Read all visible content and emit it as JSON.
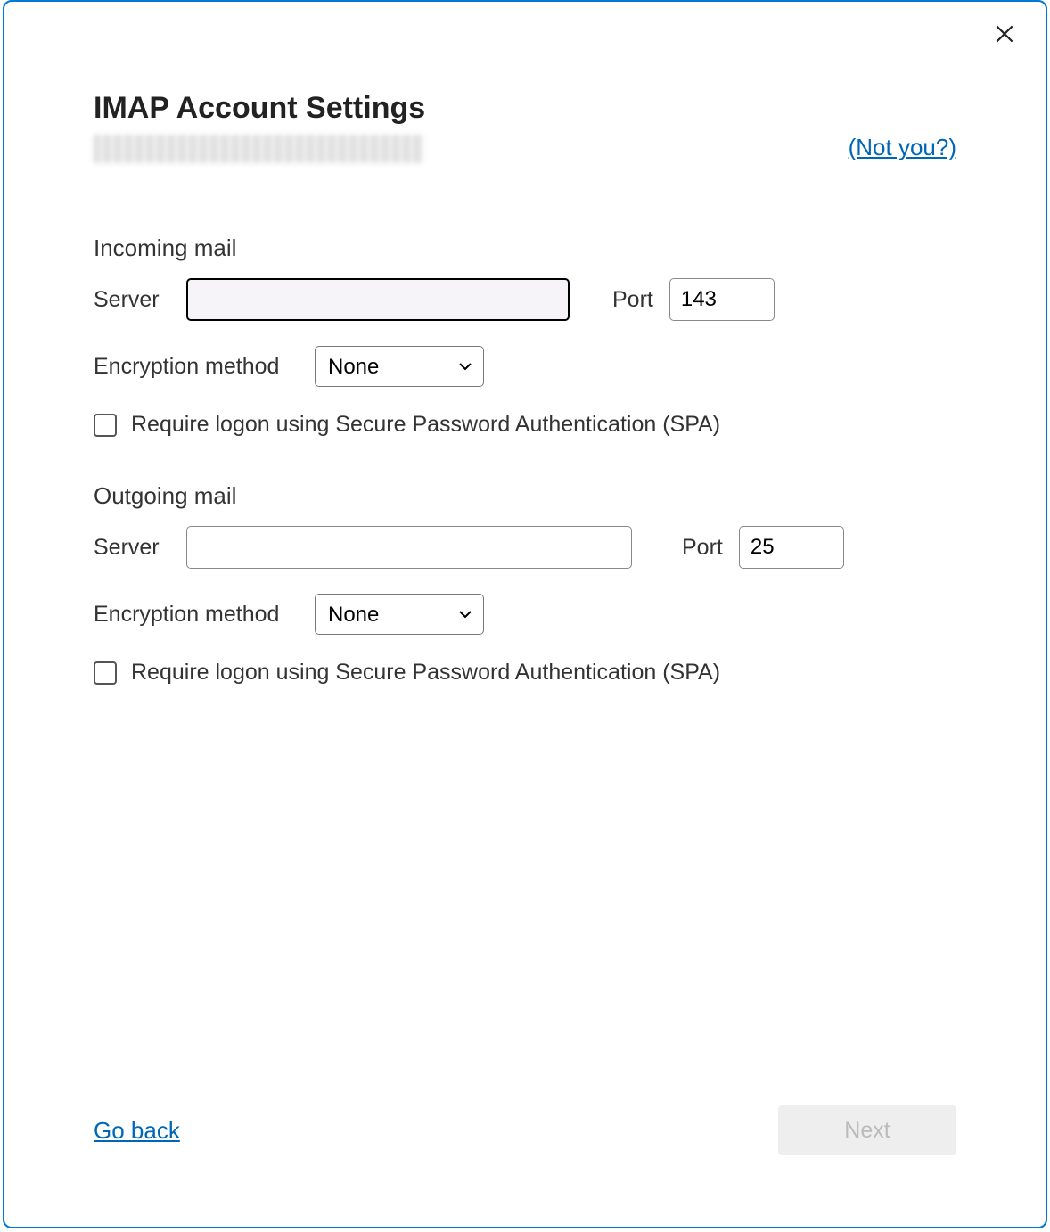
{
  "dialog": {
    "title": "IMAP Account Settings",
    "not_you": "(Not you?)"
  },
  "incoming": {
    "heading": "Incoming mail",
    "server_label": "Server",
    "server_value": "",
    "port_label": "Port",
    "port_value": "143",
    "encryption_label": "Encryption method",
    "encryption_value": "None",
    "spa_label": "Require logon using Secure Password Authentication (SPA)"
  },
  "outgoing": {
    "heading": "Outgoing mail",
    "server_label": "Server",
    "server_value": "",
    "port_label": "Port",
    "port_value": "25",
    "encryption_label": "Encryption method",
    "encryption_value": "None",
    "spa_label": "Require logon using Secure Password Authentication (SPA)"
  },
  "footer": {
    "go_back": "Go back",
    "next": "Next"
  }
}
